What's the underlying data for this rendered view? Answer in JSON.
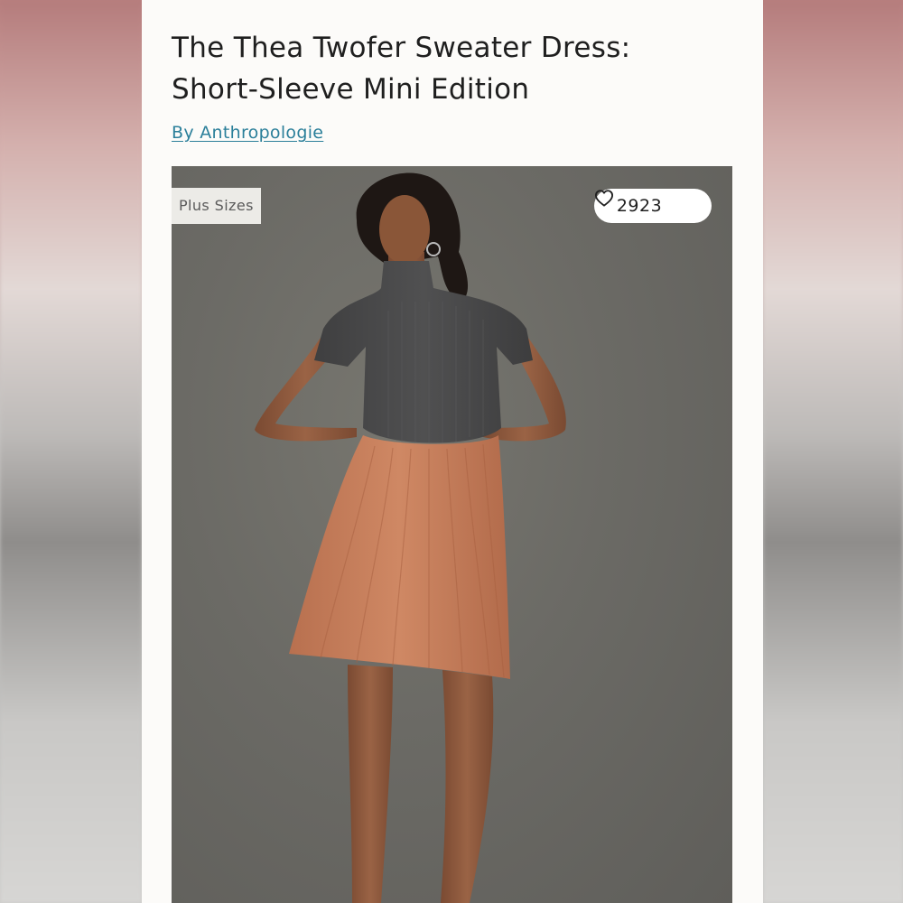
{
  "product": {
    "title_line1": "The Thea Twofer Sweater Dress:",
    "title_line2": "Short-Sleeve Mini Edition",
    "brand_link": "By Anthropologie"
  },
  "image": {
    "badge": "Plus Sizes",
    "like_count": "2923",
    "like_icon": "heart-outline-icon"
  },
  "colors": {
    "link": "#2b7f9a",
    "background": "#fcfbf9",
    "photo_backdrop": "#6b6a65",
    "sweater": "#4a4a4b",
    "skirt": "#c47d5c"
  }
}
